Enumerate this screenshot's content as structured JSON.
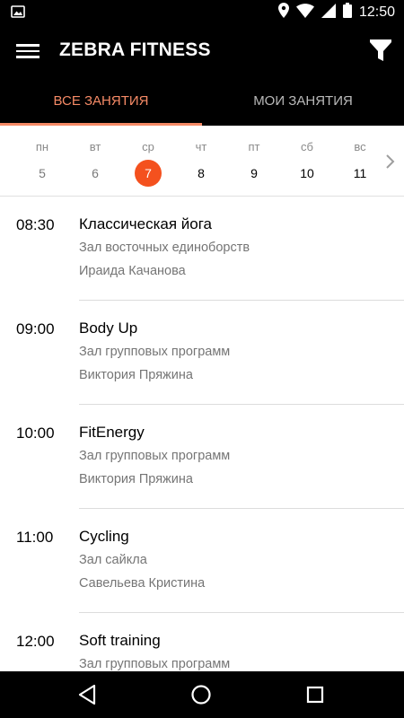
{
  "status_bar": {
    "time": "12:50",
    "icons": [
      "image-icon",
      "location-icon",
      "wifi-icon",
      "signal-icon",
      "battery-icon"
    ]
  },
  "app_bar": {
    "title": "ZEBRA FITNESS",
    "menu_icon": "menu-icon",
    "filter_icon": "filter-icon"
  },
  "tabs": [
    {
      "label": "ВСЕ ЗАНЯТИЯ",
      "active": true
    },
    {
      "label": "МОИ ЗАНЯТИЯ",
      "active": false
    }
  ],
  "calendar": {
    "days": [
      {
        "name": "пн",
        "num": "5"
      },
      {
        "name": "вт",
        "num": "6"
      },
      {
        "name": "ср",
        "num": "7"
      },
      {
        "name": "чт",
        "num": "8"
      },
      {
        "name": "пт",
        "num": "9"
      },
      {
        "name": "сб",
        "num": "10"
      },
      {
        "name": "вс",
        "num": "11"
      }
    ],
    "selected_index": 2,
    "next_icon": "chevron-right-icon"
  },
  "sessions": [
    {
      "time": "08:30",
      "title": "Классическая йога",
      "room": "Зал восточных единоборств",
      "trainer": "Ираида Качанова"
    },
    {
      "time": "09:00",
      "title": "Body Up",
      "room": "Зал групповых программ",
      "trainer": "Виктория Пряжина"
    },
    {
      "time": "10:00",
      "title": "FitEnergy",
      "room": "Зал групповых программ",
      "trainer": "Виктория Пряжина"
    },
    {
      "time": "11:00",
      "title": "Cycling",
      "room": "Зал сайкла",
      "trainer": "Савельева Кристина"
    },
    {
      "time": "12:00",
      "title": "Soft training",
      "room": "Зал групповых программ",
      "trainer": ""
    }
  ],
  "nav_bar": {
    "buttons": [
      "back-icon",
      "home-icon",
      "recents-icon"
    ]
  },
  "colors": {
    "accent": "#f58a66",
    "selected_day": "#f4511e",
    "app_bar": "#000000"
  }
}
